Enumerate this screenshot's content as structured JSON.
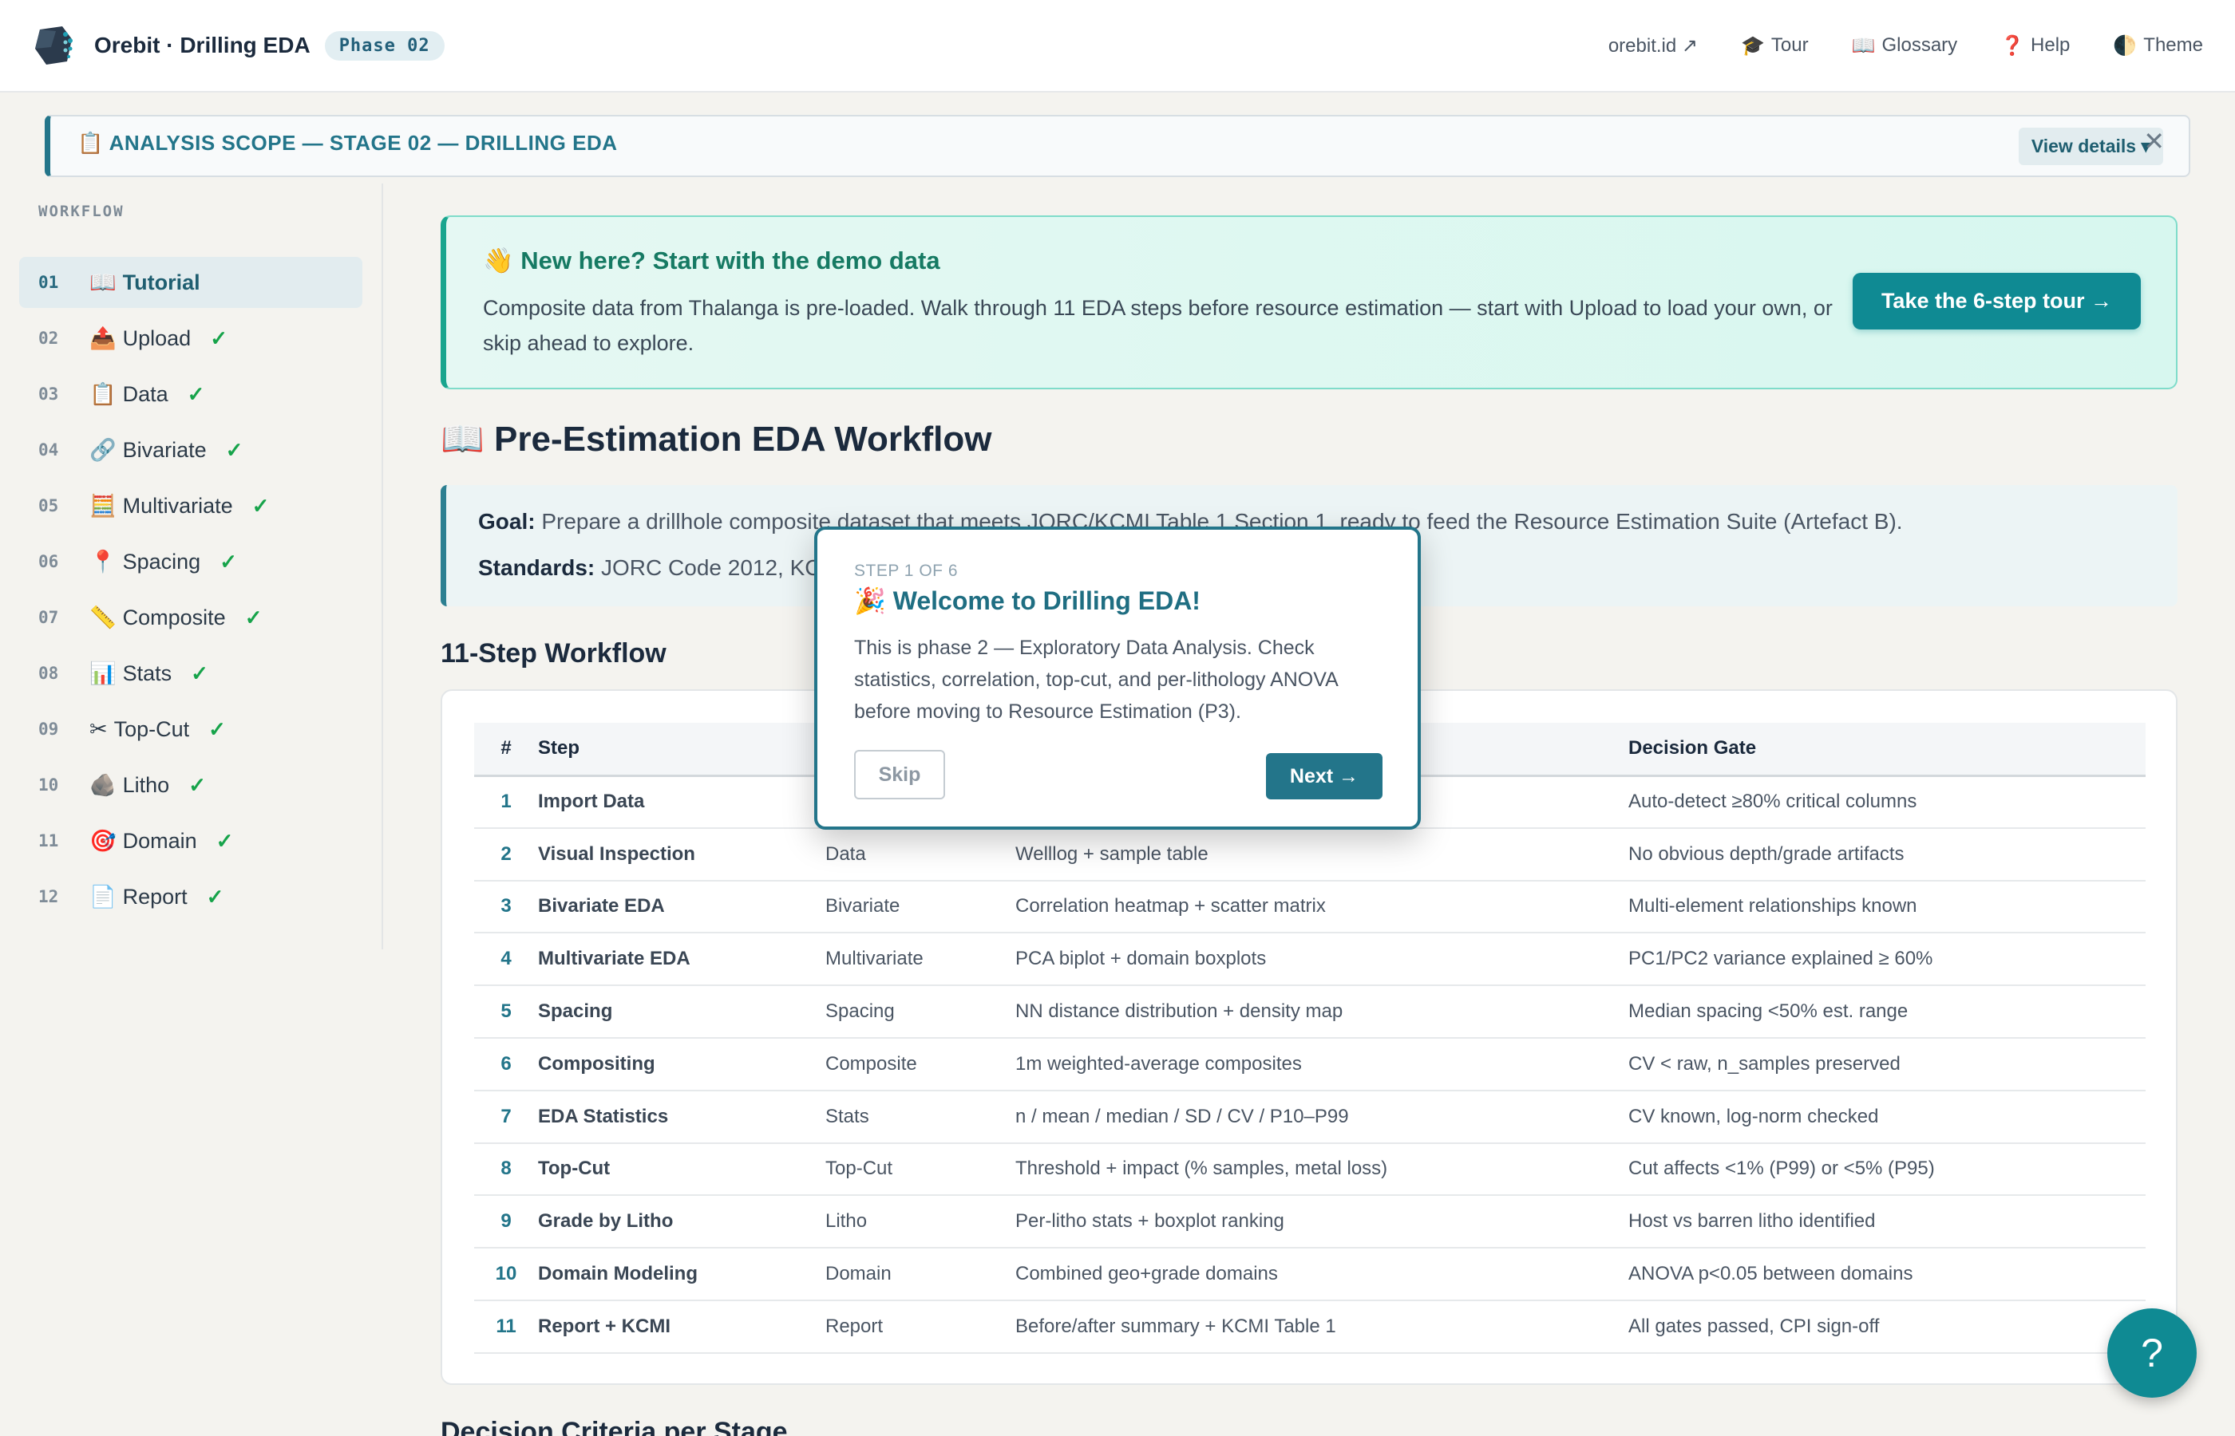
{
  "header": {
    "app_title": "Orebit · Drilling EDA",
    "phase_badge": "Phase 02",
    "nav": [
      {
        "icon": "",
        "label": "orebit.id ↗"
      },
      {
        "icon": "🎓",
        "label": "Tour"
      },
      {
        "icon": "📖",
        "label": "Glossary"
      },
      {
        "icon": "❓",
        "label": "Help"
      },
      {
        "icon": "🌓",
        "label": "Theme"
      }
    ]
  },
  "scope": {
    "icon": "📋",
    "text": "ANALYSIS SCOPE — STAGE 02 — DRILLING EDA",
    "details_label": "View details ▾",
    "close_label": "✕"
  },
  "sidebar": {
    "section_label": "WORKFLOW",
    "check": "✓",
    "items": [
      {
        "num": "01",
        "icon": "📖",
        "label": "Tutorial",
        "done": false
      },
      {
        "num": "02",
        "icon": "📤",
        "label": "Upload",
        "done": true
      },
      {
        "num": "03",
        "icon": "📋",
        "label": "Data",
        "done": true
      },
      {
        "num": "04",
        "icon": "🔗",
        "label": "Bivariate",
        "done": true
      },
      {
        "num": "05",
        "icon": "🧮",
        "label": "Multivariate",
        "done": true
      },
      {
        "num": "06",
        "icon": "📍",
        "label": "Spacing",
        "done": true
      },
      {
        "num": "07",
        "icon": "📏",
        "label": "Composite",
        "done": true
      },
      {
        "num": "08",
        "icon": "📊",
        "label": "Stats",
        "done": true
      },
      {
        "num": "09",
        "icon": "✂",
        "label": "Top-Cut",
        "done": true
      },
      {
        "num": "10",
        "icon": "🪨",
        "label": "Litho",
        "done": true
      },
      {
        "num": "11",
        "icon": "🎯",
        "label": "Domain",
        "done": true
      },
      {
        "num": "12",
        "icon": "📄",
        "label": "Report",
        "done": true
      }
    ]
  },
  "demo": {
    "title": "👋 New here? Start with the demo data",
    "body": "Composite data from Thalanga is pre-loaded. Walk through 11 EDA steps before resource estimation — start with Upload to load your own, or skip ahead to explore.",
    "tour_button": "Take the 6-step tour →"
  },
  "main": {
    "title": "📖 Pre-Estimation EDA Workflow",
    "goal_label": "Goal:",
    "goal_text": "Prepare a drillhole composite dataset that meets JORC/KCMI Table 1 Section 1, ready to feed the Resource Estimation Suite (Artefact B).",
    "standards_label": "Standards:",
    "standards_text": "JORC Code 2012, KCMI",
    "workflow_title": "11-Step Workflow",
    "next_section_title": "Decision Criteria per Stage"
  },
  "table": {
    "headers": [
      "#",
      "Step",
      "",
      "",
      "Decision Gate"
    ],
    "rows": [
      {
        "n": "1",
        "step": "Import Data",
        "module": "",
        "output": "",
        "gate": "Auto-detect ≥80% critical columns"
      },
      {
        "n": "2",
        "step": "Visual Inspection",
        "module": "Data",
        "output": "Welllog + sample table",
        "gate": "No obvious depth/grade artifacts"
      },
      {
        "n": "3",
        "step": "Bivariate EDA",
        "module": "Bivariate",
        "output": "Correlation heatmap + scatter matrix",
        "gate": "Multi-element relationships known"
      },
      {
        "n": "4",
        "step": "Multivariate EDA",
        "module": "Multivariate",
        "output": "PCA biplot + domain boxplots",
        "gate": "PC1/PC2 variance explained ≥ 60%"
      },
      {
        "n": "5",
        "step": "Spacing",
        "module": "Spacing",
        "output": "NN distance distribution + density map",
        "gate": "Median spacing <50% est. range"
      },
      {
        "n": "6",
        "step": "Compositing",
        "module": "Composite",
        "output": "1m weighted-average composites",
        "gate": "CV < raw, n_samples preserved"
      },
      {
        "n": "7",
        "step": "EDA Statistics",
        "module": "Stats",
        "output": "n / mean / median / SD / CV / P10–P99",
        "gate": "CV known, log-norm checked"
      },
      {
        "n": "8",
        "step": "Top-Cut",
        "module": "Top-Cut",
        "output": "Threshold + impact (% samples, metal loss)",
        "gate": "Cut affects <1% (P99) or <5% (P95)"
      },
      {
        "n": "9",
        "step": "Grade by Litho",
        "module": "Litho",
        "output": "Per-litho stats + boxplot ranking",
        "gate": "Host vs barren litho identified"
      },
      {
        "n": "10",
        "step": "Domain Modeling",
        "module": "Domain",
        "output": "Combined geo+grade domains",
        "gate": "ANOVA p<0.05 between domains"
      },
      {
        "n": "11",
        "step": "Report + KCMI",
        "module": "Report",
        "output": "Before/after summary + KCMI Table 1",
        "gate": "All gates passed, CPI sign-off"
      }
    ]
  },
  "popup": {
    "step_label": "STEP 1 OF 6",
    "title": "🎉 Welcome to Drilling EDA!",
    "body": "This is phase 2 — Exploratory Data Analysis. Check statistics, correlation, top-cut, and per-lithology ANOVA before moving to Resource Estimation (P3).",
    "skip": "Skip",
    "next": "Next →"
  },
  "help_fab": "?"
}
